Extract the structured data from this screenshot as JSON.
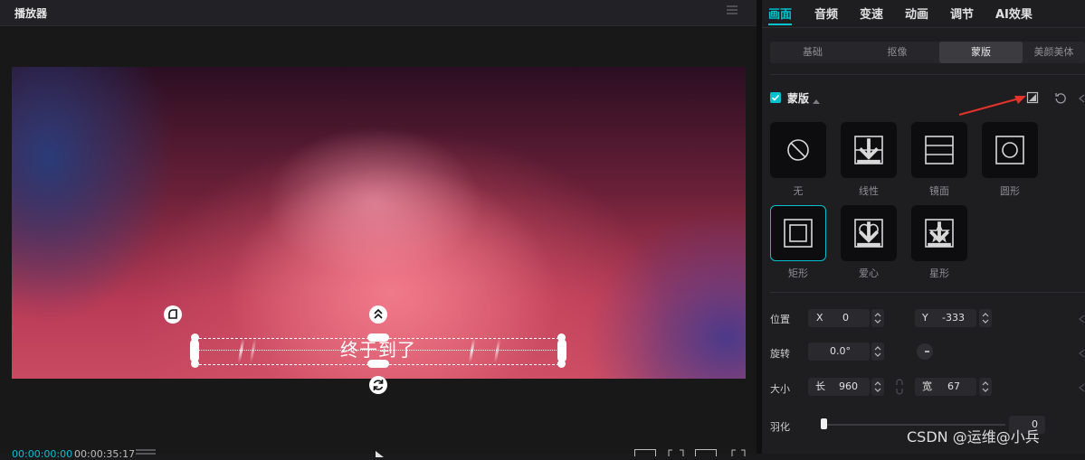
{
  "player": {
    "title": "播放器",
    "subtitle": "终于到了",
    "time_current": "00:00:00:00",
    "time_total": "00:00:35:17"
  },
  "panel": {
    "tabs": [
      "画面",
      "音频",
      "变速",
      "动画",
      "调节",
      "AI效果"
    ],
    "active_tab": "画面",
    "subtabs": [
      "基础",
      "抠像",
      "蒙版",
      "美颜美体"
    ],
    "active_subtab": "蒙版",
    "mask": {
      "title": "蒙版",
      "enabled": true,
      "presets": [
        {
          "label": "无",
          "icon": "none-icon"
        },
        {
          "label": "线性",
          "icon": "linear-mask-icon"
        },
        {
          "label": "镜面",
          "icon": "mirror-mask-icon"
        },
        {
          "label": "圆形",
          "icon": "circle-mask-icon"
        },
        {
          "label": "矩形",
          "icon": "rectangle-mask-icon"
        },
        {
          "label": "爱心",
          "icon": "heart-mask-icon"
        },
        {
          "label": "星形",
          "icon": "star-mask-icon"
        }
      ],
      "selected": "矩形"
    },
    "props": {
      "position_label": "位置",
      "x_label": "X",
      "x_value": "0",
      "y_label": "Y",
      "y_value": "-333",
      "rotate_label": "旋转",
      "rotate_value": "0.0°",
      "size_label": "大小",
      "w_label": "长",
      "w_value": "960",
      "h_label": "宽",
      "h_value": "67",
      "feather_label": "羽化",
      "feather_value": "0"
    }
  },
  "watermark": "CSDN @运维@小兵",
  "colors": {
    "accent": "#00c1cd",
    "arrow": "#e5332a"
  }
}
